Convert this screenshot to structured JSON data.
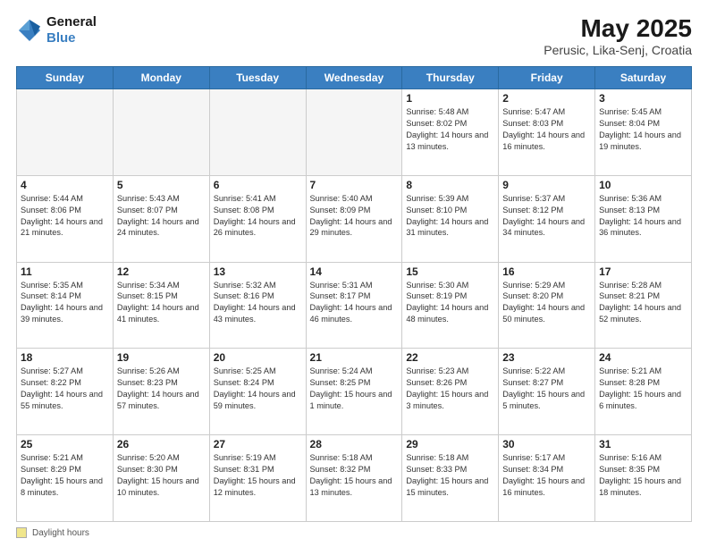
{
  "header": {
    "logo_line1": "General",
    "logo_line2": "Blue",
    "title": "May 2025",
    "subtitle": "Perusic, Lika-Senj, Croatia"
  },
  "footer": {
    "label": "Daylight hours"
  },
  "days_of_week": [
    "Sunday",
    "Monday",
    "Tuesday",
    "Wednesday",
    "Thursday",
    "Friday",
    "Saturday"
  ],
  "weeks": [
    [
      {
        "num": "",
        "info": ""
      },
      {
        "num": "",
        "info": ""
      },
      {
        "num": "",
        "info": ""
      },
      {
        "num": "",
        "info": ""
      },
      {
        "num": "1",
        "info": "Sunrise: 5:48 AM\nSunset: 8:02 PM\nDaylight: 14 hours\nand 13 minutes."
      },
      {
        "num": "2",
        "info": "Sunrise: 5:47 AM\nSunset: 8:03 PM\nDaylight: 14 hours\nand 16 minutes."
      },
      {
        "num": "3",
        "info": "Sunrise: 5:45 AM\nSunset: 8:04 PM\nDaylight: 14 hours\nand 19 minutes."
      }
    ],
    [
      {
        "num": "4",
        "info": "Sunrise: 5:44 AM\nSunset: 8:06 PM\nDaylight: 14 hours\nand 21 minutes."
      },
      {
        "num": "5",
        "info": "Sunrise: 5:43 AM\nSunset: 8:07 PM\nDaylight: 14 hours\nand 24 minutes."
      },
      {
        "num": "6",
        "info": "Sunrise: 5:41 AM\nSunset: 8:08 PM\nDaylight: 14 hours\nand 26 minutes."
      },
      {
        "num": "7",
        "info": "Sunrise: 5:40 AM\nSunset: 8:09 PM\nDaylight: 14 hours\nand 29 minutes."
      },
      {
        "num": "8",
        "info": "Sunrise: 5:39 AM\nSunset: 8:10 PM\nDaylight: 14 hours\nand 31 minutes."
      },
      {
        "num": "9",
        "info": "Sunrise: 5:37 AM\nSunset: 8:12 PM\nDaylight: 14 hours\nand 34 minutes."
      },
      {
        "num": "10",
        "info": "Sunrise: 5:36 AM\nSunset: 8:13 PM\nDaylight: 14 hours\nand 36 minutes."
      }
    ],
    [
      {
        "num": "11",
        "info": "Sunrise: 5:35 AM\nSunset: 8:14 PM\nDaylight: 14 hours\nand 39 minutes."
      },
      {
        "num": "12",
        "info": "Sunrise: 5:34 AM\nSunset: 8:15 PM\nDaylight: 14 hours\nand 41 minutes."
      },
      {
        "num": "13",
        "info": "Sunrise: 5:32 AM\nSunset: 8:16 PM\nDaylight: 14 hours\nand 43 minutes."
      },
      {
        "num": "14",
        "info": "Sunrise: 5:31 AM\nSunset: 8:17 PM\nDaylight: 14 hours\nand 46 minutes."
      },
      {
        "num": "15",
        "info": "Sunrise: 5:30 AM\nSunset: 8:19 PM\nDaylight: 14 hours\nand 48 minutes."
      },
      {
        "num": "16",
        "info": "Sunrise: 5:29 AM\nSunset: 8:20 PM\nDaylight: 14 hours\nand 50 minutes."
      },
      {
        "num": "17",
        "info": "Sunrise: 5:28 AM\nSunset: 8:21 PM\nDaylight: 14 hours\nand 52 minutes."
      }
    ],
    [
      {
        "num": "18",
        "info": "Sunrise: 5:27 AM\nSunset: 8:22 PM\nDaylight: 14 hours\nand 55 minutes."
      },
      {
        "num": "19",
        "info": "Sunrise: 5:26 AM\nSunset: 8:23 PM\nDaylight: 14 hours\nand 57 minutes."
      },
      {
        "num": "20",
        "info": "Sunrise: 5:25 AM\nSunset: 8:24 PM\nDaylight: 14 hours\nand 59 minutes."
      },
      {
        "num": "21",
        "info": "Sunrise: 5:24 AM\nSunset: 8:25 PM\nDaylight: 15 hours\nand 1 minute."
      },
      {
        "num": "22",
        "info": "Sunrise: 5:23 AM\nSunset: 8:26 PM\nDaylight: 15 hours\nand 3 minutes."
      },
      {
        "num": "23",
        "info": "Sunrise: 5:22 AM\nSunset: 8:27 PM\nDaylight: 15 hours\nand 5 minutes."
      },
      {
        "num": "24",
        "info": "Sunrise: 5:21 AM\nSunset: 8:28 PM\nDaylight: 15 hours\nand 6 minutes."
      }
    ],
    [
      {
        "num": "25",
        "info": "Sunrise: 5:21 AM\nSunset: 8:29 PM\nDaylight: 15 hours\nand 8 minutes."
      },
      {
        "num": "26",
        "info": "Sunrise: 5:20 AM\nSunset: 8:30 PM\nDaylight: 15 hours\nand 10 minutes."
      },
      {
        "num": "27",
        "info": "Sunrise: 5:19 AM\nSunset: 8:31 PM\nDaylight: 15 hours\nand 12 minutes."
      },
      {
        "num": "28",
        "info": "Sunrise: 5:18 AM\nSunset: 8:32 PM\nDaylight: 15 hours\nand 13 minutes."
      },
      {
        "num": "29",
        "info": "Sunrise: 5:18 AM\nSunset: 8:33 PM\nDaylight: 15 hours\nand 15 minutes."
      },
      {
        "num": "30",
        "info": "Sunrise: 5:17 AM\nSunset: 8:34 PM\nDaylight: 15 hours\nand 16 minutes."
      },
      {
        "num": "31",
        "info": "Sunrise: 5:16 AM\nSunset: 8:35 PM\nDaylight: 15 hours\nand 18 minutes."
      }
    ]
  ]
}
